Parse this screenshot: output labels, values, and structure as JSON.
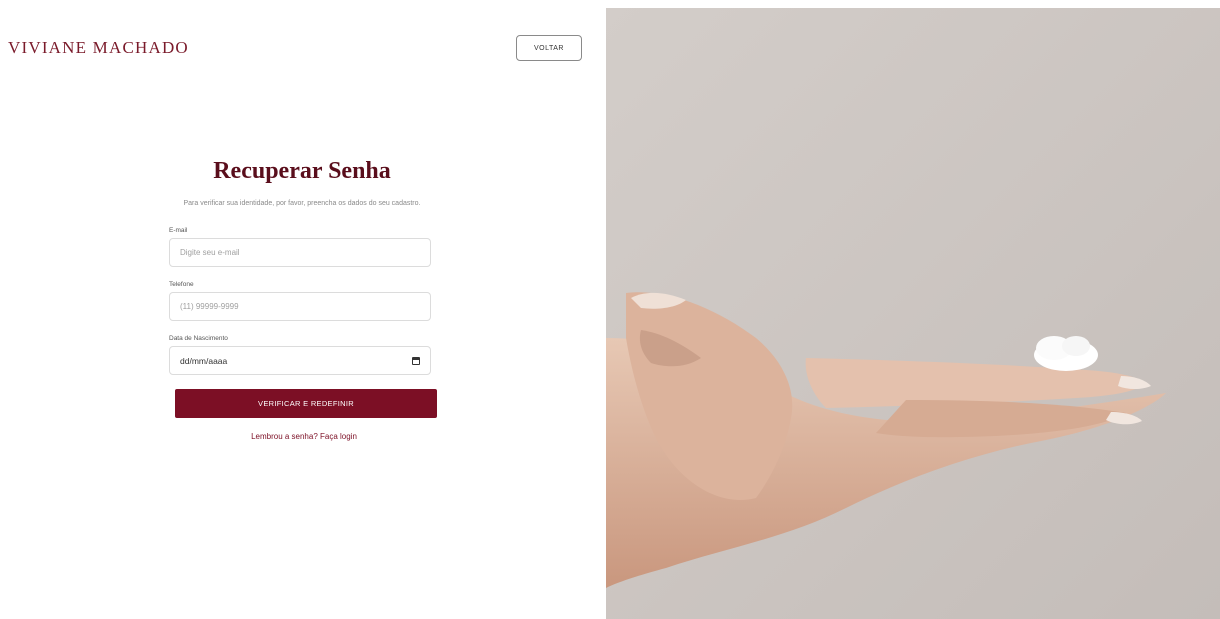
{
  "header": {
    "brand": "VIVIANE MACHADO",
    "back_label": "VOLTAR"
  },
  "form": {
    "title": "Recuperar Senha",
    "subtitle": "Para verificar sua identidade, por favor, preencha os dados do seu cadastro.",
    "email": {
      "label": "E-mail",
      "placeholder": "Digite seu e-mail"
    },
    "phone": {
      "label": "Telefone",
      "placeholder": "(11) 99999-9999"
    },
    "birthdate": {
      "label": "Data de Nascimento",
      "value": "dd/mm/aaaa"
    },
    "submit_label": "VERIFICAR E REDEFINIR",
    "login_prompt": "Lembrou a senha?",
    "login_link": "Faça login"
  },
  "colors": {
    "brand": "#7a1a2a",
    "primary_button": "#7c0f25",
    "title": "#5a0e1c",
    "photo_background": "#cdc6c2"
  },
  "icons": {
    "date_picker": "calendar-icon"
  }
}
